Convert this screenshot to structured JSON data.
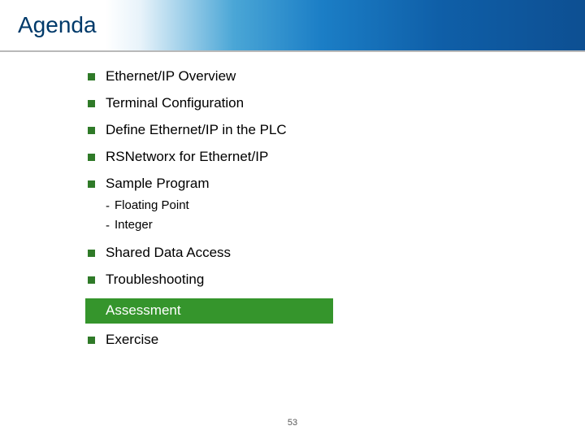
{
  "header": {
    "title": "Agenda"
  },
  "agenda": {
    "items": [
      {
        "label": "Ethernet/IP Overview"
      },
      {
        "label": "Terminal Configuration"
      },
      {
        "label": "Define Ethernet/IP in the PLC"
      },
      {
        "label": "RSNetworx for Ethernet/IP"
      },
      {
        "label": "Sample Program",
        "children": [
          "Floating Point",
          "Integer"
        ]
      },
      {
        "label": "Shared Data Access"
      },
      {
        "label": "Troubleshooting"
      }
    ],
    "highlight": {
      "label": "Assessment"
    },
    "after": [
      {
        "label": "Exercise"
      }
    ]
  },
  "footer": {
    "page_number": "53"
  },
  "colors": {
    "accent_green": "#35952c",
    "bullet_green": "#2f7a28",
    "header_gradient_end": "#0d4f92",
    "title_color": "#003a6a"
  }
}
